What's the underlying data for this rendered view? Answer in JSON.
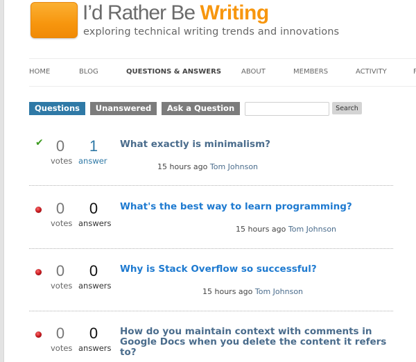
{
  "header": {
    "title_prefix": "I’d Rather Be ",
    "title_accent": "Writing",
    "tagline": "exploring technical writing trends and innovations",
    "brand_color": "#f7960e"
  },
  "nav": {
    "items": [
      {
        "label": "HOME",
        "active": false
      },
      {
        "label": "BLOG",
        "active": false
      },
      {
        "label": "QUESTIONS & ANSWERS",
        "active": true
      },
      {
        "label": "ABOUT",
        "active": false
      },
      {
        "label": "MEMBERS",
        "active": false
      },
      {
        "label": "ACTIVITY",
        "active": false
      },
      {
        "label": "F",
        "active": false
      }
    ]
  },
  "tabs": [
    {
      "label": "Questions",
      "active": true
    },
    {
      "label": "Unanswered",
      "active": false
    },
    {
      "label": "Ask a Question",
      "active": false
    }
  ],
  "search": {
    "value": "",
    "placeholder": "",
    "button_label": "Search"
  },
  "questions": [
    {
      "status": "answered",
      "status_icon": "check-icon",
      "votes": "0",
      "votes_label": "votes",
      "answers": "1",
      "answers_label": "answer",
      "title": "What exactly is minimalism?",
      "time": "15 hours ago",
      "author": "Tom Johnson"
    },
    {
      "status": "unanswered",
      "status_icon": "red-dot-icon",
      "votes": "0",
      "votes_label": "votes",
      "answers": "0",
      "answers_label": "answers",
      "title": "What's the best way to learn programming?",
      "time": "15 hours ago",
      "author": "Tom Johnson"
    },
    {
      "status": "unanswered",
      "status_icon": "red-dot-icon",
      "votes": "0",
      "votes_label": "votes",
      "answers": "0",
      "answers_label": "answers",
      "title": "Why is Stack Overflow so successful?",
      "time": "15 hours ago",
      "author": "Tom Johnson"
    },
    {
      "status": "unanswered",
      "status_icon": "red-dot-icon",
      "votes": "0",
      "votes_label": "votes",
      "answers": "0",
      "answers_label": "answers",
      "title": "How do you maintain context with comments in Google Docs when you delete the content it refers to?",
      "time": "",
      "author": ""
    }
  ]
}
